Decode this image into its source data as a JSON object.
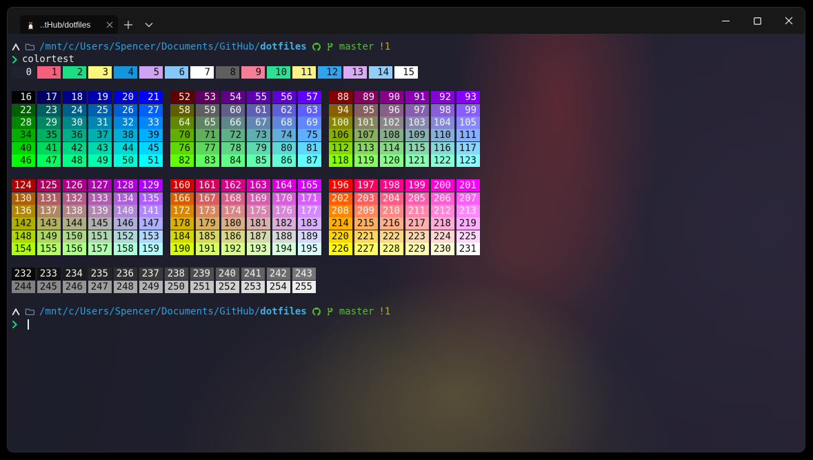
{
  "window": {
    "tab": {
      "title": "..tHub/dotfiles",
      "icon": "linux-tux-icon",
      "close_icon": "close-icon"
    },
    "new_tab_icon": "plus-icon",
    "dropdown_icon": "chevron-down-icon",
    "controls": [
      {
        "label": "minimize",
        "icon": "minimize-icon"
      },
      {
        "label": "maximize",
        "icon": "maximize-icon"
      },
      {
        "label": "close",
        "icon": "close-icon"
      }
    ]
  },
  "terminal": {
    "prompt_segments": [
      {
        "type": "icon",
        "name": "caret-up-icon",
        "color": "#e8e8e8"
      },
      {
        "type": "icon",
        "name": "folder-icon",
        "color": "#7d8dab"
      },
      {
        "type": "path",
        "prefix": "/mnt/c/Users/Spencer/Documents/GitHub/",
        "name_part": "dotfiles",
        "prefix_color": "#2f9ed9",
        "name_color": "#3fb1e3"
      },
      {
        "type": "icon",
        "name": "github-icon",
        "color": "#55bd33"
      },
      {
        "type": "icon",
        "name": "git-branch-icon",
        "color": "#55bd33"
      },
      {
        "type": "text",
        "text": "master",
        "color": "#55bd33"
      },
      {
        "type": "text",
        "text": "!1",
        "color": "#c0a62d"
      }
    ],
    "command": {
      "symbol_icon": "chevron-right-icon",
      "symbol_color": "#1bdd84",
      "text": "colortest",
      "text_color": "#e6e6e6"
    },
    "ansi_row": [
      0,
      1,
      2,
      3,
      4,
      5,
      6,
      7,
      8,
      9,
      10,
      11,
      12,
      13,
      14,
      15
    ],
    "cube_sections": [
      {
        "rows": [
          {
            "groups": [
              [
                16,
                21
              ],
              [
                52,
                57
              ],
              [
                88,
                93
              ]
            ]
          },
          {
            "groups": [
              [
                22,
                27
              ],
              [
                58,
                63
              ],
              [
                94,
                99
              ]
            ]
          },
          {
            "groups": [
              [
                28,
                33
              ],
              [
                64,
                69
              ],
              [
                100,
                105
              ]
            ]
          },
          {
            "groups": [
              [
                34,
                39
              ],
              [
                70,
                75
              ],
              [
                106,
                111
              ]
            ]
          },
          {
            "groups": [
              [
                40,
                45
              ],
              [
                76,
                81
              ],
              [
                112,
                117
              ]
            ]
          },
          {
            "groups": [
              [
                46,
                51
              ],
              [
                82,
                87
              ],
              [
                118,
                123
              ]
            ]
          }
        ]
      },
      {
        "rows": [
          {
            "groups": [
              [
                124,
                129
              ],
              [
                160,
                165
              ],
              [
                196,
                201
              ]
            ]
          },
          {
            "groups": [
              [
                130,
                135
              ],
              [
                166,
                171
              ],
              [
                202,
                207
              ]
            ]
          },
          {
            "groups": [
              [
                136,
                141
              ],
              [
                172,
                177
              ],
              [
                208,
                213
              ]
            ]
          },
          {
            "groups": [
              [
                142,
                147
              ],
              [
                178,
                183
              ],
              [
                214,
                219
              ]
            ]
          },
          {
            "groups": [
              [
                148,
                153
              ],
              [
                184,
                189
              ],
              [
                220,
                225
              ]
            ]
          },
          {
            "groups": [
              [
                154,
                159
              ],
              [
                190,
                195
              ],
              [
                226,
                231
              ]
            ]
          }
        ]
      }
    ],
    "gray_rows": [
      [
        232,
        243
      ],
      [
        244,
        255
      ]
    ],
    "cursor": {
      "symbol_icon": "chevron-right-icon",
      "symbol_color": "#1bdd84"
    }
  },
  "palette": {
    "ansi16": [
      "#20222f",
      "#f2607c",
      "#1bdd84",
      "#f9f77c",
      "#1496dd",
      "#cfa2f4",
      "#86c7f7",
      "#ffffff",
      "#5f5f5f",
      "#f67d97",
      "#2ae295",
      "#f9f288",
      "#2fa4ef",
      "#d8abf6",
      "#94cef7",
      "#ffffff"
    ],
    "cube_levels": [
      0,
      95,
      135,
      175,
      215,
      255
    ],
    "gray_start": 8,
    "gray_step": 10,
    "fg_white": "#f2f2f2",
    "fg_black": "#0d0d0d"
  }
}
